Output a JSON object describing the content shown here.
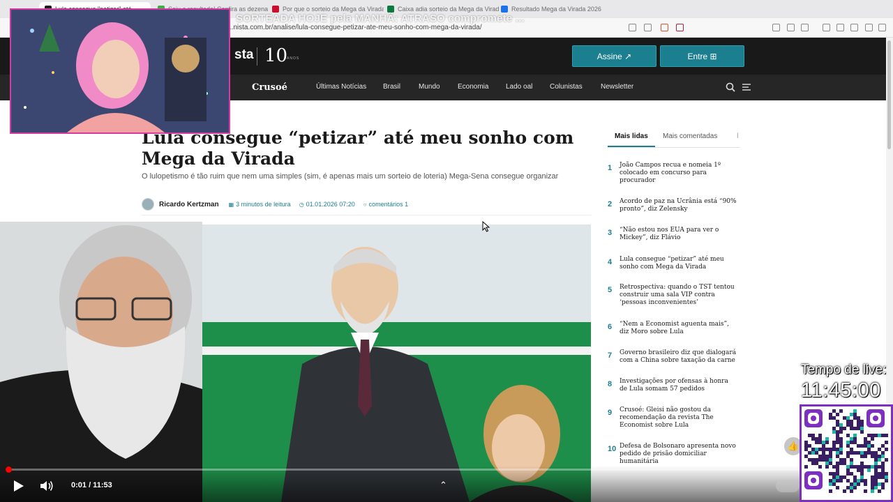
{
  "browser": {
    "tabs": [
      {
        "label": "Lula consegue \"petizar\" até...",
        "color": "#1e1e1e"
      },
      {
        "label": "Saiu o resultado! Confira as dezenas",
        "color": "#3cb043"
      },
      {
        "label": "Por que o sorteio da Mega da Virada",
        "color": "#c8102e"
      },
      {
        "label": "Caixa adia sorteio da Mega da Virada",
        "color": "#0a7a3e"
      },
      {
        "label": "Resultado Mega da Virada 2026",
        "color": "#1a73e8"
      }
    ],
    "url": "...nista.com.br/analise/lula-consegue-petizar-ate-meu-sonho-com-mega-da-virada/",
    "overlay_ticker": "SORTEADA HOJE pela MANHÃ: ATRASO compromete ..."
  },
  "site": {
    "brand_partial": "sta",
    "brand_10": "10",
    "brand_anos": "ANOS",
    "subscribe_label": "Assine ↗",
    "login_label": "Entre ⊞",
    "nav_logo": "Crusoé",
    "nav": [
      "Últimas Notícias",
      "Brasil",
      "Mundo",
      "Economia",
      "Lado oal",
      "Colunistas",
      "Newsletter"
    ],
    "icons": {
      "search": "search-icon",
      "menu": "hamburger-menu-icon"
    }
  },
  "article": {
    "headline": "Lula consegue “petizar” até meu sonho com Mega da Virada",
    "subheadline": "O lulopetismo é tão ruim que nem uma simples (sim, é apenas mais um sorteio de loteria) Mega-Sena consegue organizar",
    "author": "Ricardo Kertzman",
    "read_time": "3 minutos de leitura",
    "date": "01.01.2026 07:20",
    "comments": "comentários 1"
  },
  "sidebar": {
    "tab_most_read": "Mais lidas",
    "tab_most_commented": "Mais comentadas",
    "items": [
      {
        "rank": "1",
        "title": "João Campos recua e nomeia 1º colocado em concurso para procurador"
      },
      {
        "rank": "2",
        "title": "Acordo de paz na Ucrânia está “90% pronto”, diz Zelensky"
      },
      {
        "rank": "3",
        "title": "“Não estou nos EUA para ver o Mickey”, diz Flávio"
      },
      {
        "rank": "4",
        "title": "Lula consegue “petizar” até meu sonho com Mega da Virada"
      },
      {
        "rank": "5",
        "title": "Retrospectiva: quando o TST tentou construir uma sala VIP contra ‘pessoas inconvenientes’"
      },
      {
        "rank": "6",
        "title": "“Nem a Economist aguenta mais”, diz Moro sobre Lula"
      },
      {
        "rank": "7",
        "title": "Governo brasileiro diz que dialogará com a China sobre taxação da carne"
      },
      {
        "rank": "8",
        "title": "Investigações por ofensas à honra de Lula somam 57 pedidos"
      },
      {
        "rank": "9",
        "title": "Crusoé: Gleisi não gostou da recomendação da revista The Economist sobre Lula"
      },
      {
        "rank": "10",
        "title": "Defesa de Bolsonaro apresenta novo pedido de prisão domiciliar humanitária"
      }
    ]
  },
  "video": {
    "time": "0:01 / 11:53",
    "progress": 0.0014,
    "live_label": "Tempo de live:",
    "live_time": "11:45:00"
  },
  "colors": {
    "accent": "#1c7f90",
    "overlay_border": "#d63aa0",
    "qr_border": "#7d2fc0",
    "progress": "#ff0000"
  }
}
